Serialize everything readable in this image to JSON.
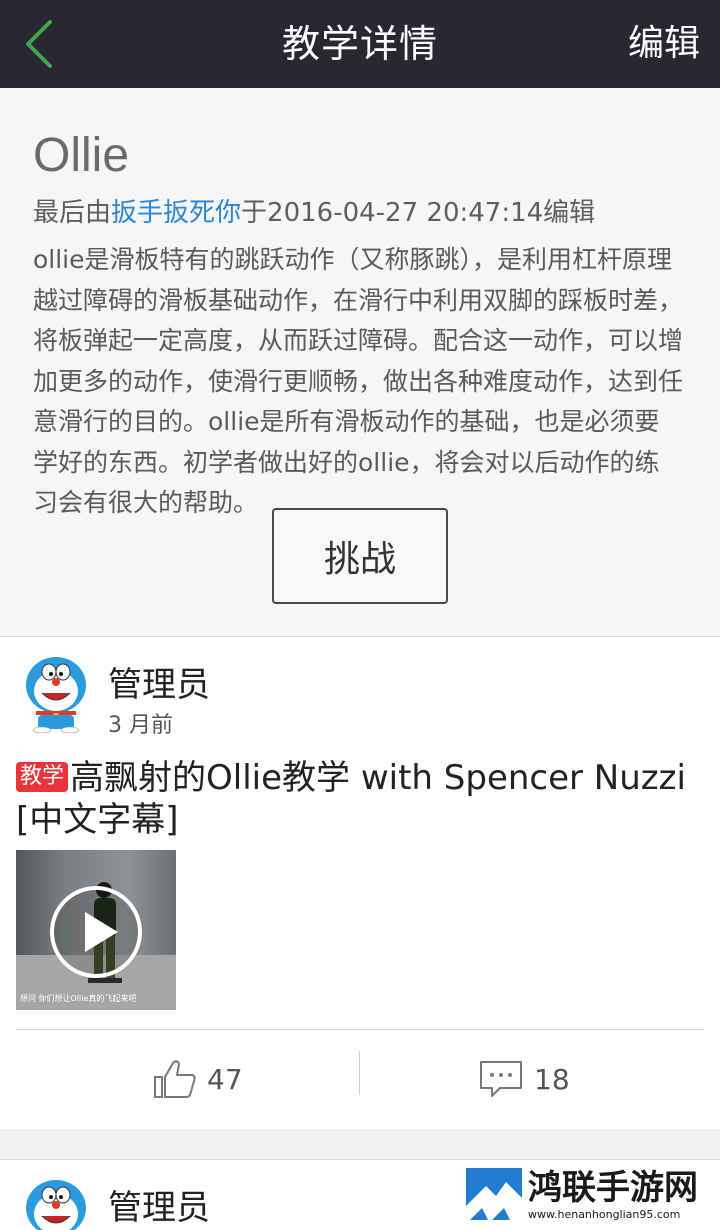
{
  "header": {
    "title": "教学详情",
    "edit_label": "编辑"
  },
  "detail": {
    "title": "Ollie",
    "meta_prefix": "最后由",
    "author": "扳手扳死你",
    "meta_suffix": "于2016-04-27 20:47:14编辑",
    "description": "ollie是滑板特有的跳跃动作（又称豚跳），是利用杠杆原理越过障碍的滑板基础动作，在滑行中利用双脚的踩板时差，将板弹起一定高度，从而跃过障碍。配合这一动作，可以增加更多的动作，使滑行更顺畅，做出各种难度动作，达到任意滑行的目的。ollie是所有滑板动作的基础，也是必须要学好的东西。初学者做出好的ollie，将会对以后动作的练习会有很大的帮助。",
    "challenge_label": "挑战"
  },
  "posts": [
    {
      "poster": "管理员",
      "time": "3 月前",
      "tag": "教学",
      "title": "高飘射的Ollie教学 with Spencer Nuzzi [中文字幕]",
      "thumbnail_caption": "想问 你们想让Ollie真的飞起来吧",
      "likes": "47",
      "comments": "18"
    },
    {
      "poster": "管理员"
    }
  ],
  "watermark": {
    "name": "鸿联手游网",
    "url": "www.henanhonglian95.com"
  },
  "colors": {
    "topbar": "#2b2730",
    "back_arrow": "#3aa84b",
    "author_link": "#2b86d4",
    "tag_badge": "#e8353b"
  }
}
